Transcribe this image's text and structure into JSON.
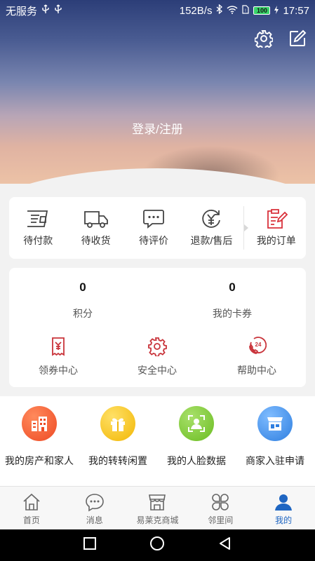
{
  "status_bar": {
    "carrier": "无服务",
    "net_speed": "152B/s",
    "battery": "100",
    "time": "17:57"
  },
  "header": {
    "login_label": "登录/注册",
    "icons": [
      "settings-icon",
      "edit-icon"
    ]
  },
  "orders": {
    "items": [
      {
        "label": "待付款",
        "icon": "wallet-icon"
      },
      {
        "label": "待收货",
        "icon": "truck-icon"
      },
      {
        "label": "待评价",
        "icon": "comment-icon"
      },
      {
        "label": "退款/售后",
        "icon": "refund-icon"
      }
    ],
    "my_orders": {
      "label": "我的订单",
      "icon": "clipboard-icon",
      "color": "#d9303a"
    }
  },
  "stats": {
    "points": {
      "value": "0",
      "label": "积分"
    },
    "coupons": {
      "value": "0",
      "label": "我的卡券"
    }
  },
  "services": [
    {
      "label": "领券中心",
      "icon": "coupon-receipt-icon"
    },
    {
      "label": "安全中心",
      "icon": "gear-icon"
    },
    {
      "label": "帮助中心",
      "icon": "24h-phone-icon"
    }
  ],
  "features": [
    {
      "label": "我的房产和家人",
      "icon": "building-icon",
      "color": "#f05a2f"
    },
    {
      "label": "我的转转闲置",
      "icon": "gift-box-icon",
      "color": "#f6c20f"
    },
    {
      "label": "我的人脸数据",
      "icon": "face-id-icon",
      "color": "#7cc730"
    },
    {
      "label": "商家入驻申请",
      "icon": "store-icon",
      "color": "#3d8fe8"
    }
  ],
  "tabbar": {
    "tabs": [
      {
        "label": "首页",
        "icon": "home-icon"
      },
      {
        "label": "消息",
        "icon": "message-icon"
      },
      {
        "label": "易莱克商城",
        "icon": "shop-icon"
      },
      {
        "label": "邻里间",
        "icon": "grid-clover-icon"
      },
      {
        "label": "我的",
        "icon": "user-icon",
        "active": true
      }
    ],
    "active_color": "#1f66c2"
  }
}
